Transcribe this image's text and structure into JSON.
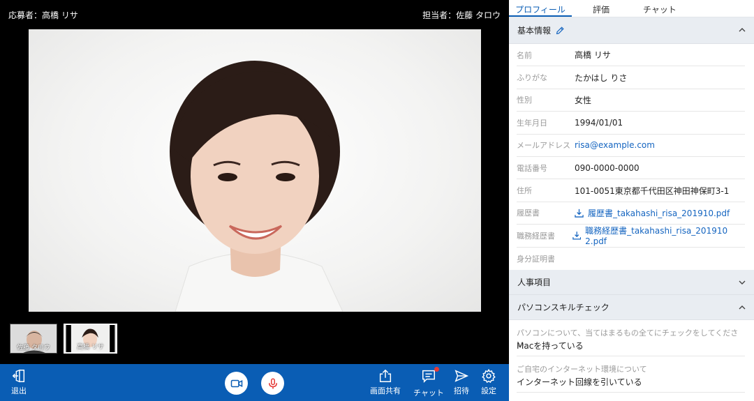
{
  "video": {
    "applicant_label": "応募者：高橋 リサ",
    "interviewer_label": "担当者：佐藤 タロウ",
    "thumbnails": [
      {
        "name": "佐藤 タロウ"
      },
      {
        "name": "高橋 リサ"
      }
    ]
  },
  "toolbar": {
    "exit_label": "退出",
    "screen_share_label": "画面共有",
    "chat_label": "チャット",
    "invite_label": "招待",
    "settings_label": "設定"
  },
  "tabs": [
    {
      "label": "プロフィール",
      "active": true
    },
    {
      "label": "評価",
      "active": false
    },
    {
      "label": "チャット",
      "active": false
    }
  ],
  "basic_info": {
    "title": "基本情報",
    "rows": [
      {
        "label": "名前",
        "value": "高橋 リサ"
      },
      {
        "label": "ふりがな",
        "value": "たかはし りさ"
      },
      {
        "label": "性別",
        "value": "女性"
      },
      {
        "label": "生年月日",
        "value": "1994/01/01"
      },
      {
        "label": "メールアドレス",
        "value": "risa@example.com"
      },
      {
        "label": "電話番号",
        "value": "090-0000-0000"
      },
      {
        "label": "住所",
        "value": "101-0051東京都千代田区神田神保町3-1"
      },
      {
        "label": "履歴書",
        "value": "履歴書_takahashi_risa_201910.pdf"
      },
      {
        "label": "職務経歴書",
        "value": "職務経歴書_takahashi_risa_201910 2.pdf"
      },
      {
        "label": "身分証明書",
        "value": ""
      }
    ]
  },
  "hr_items": {
    "title": "人事項目"
  },
  "pc_skill": {
    "title": "パソコンスキルチェック",
    "questions": [
      {
        "question": "パソコンについて、当てはまるもの全てにチェックをしてください",
        "answer": "Macを持っている"
      },
      {
        "question": "ご自宅のインターネット環境について",
        "answer": "インターネット回線を引いている"
      }
    ]
  },
  "colors": {
    "accent": "#0a5db4",
    "link": "#1565c0",
    "mic": "#e53935"
  }
}
